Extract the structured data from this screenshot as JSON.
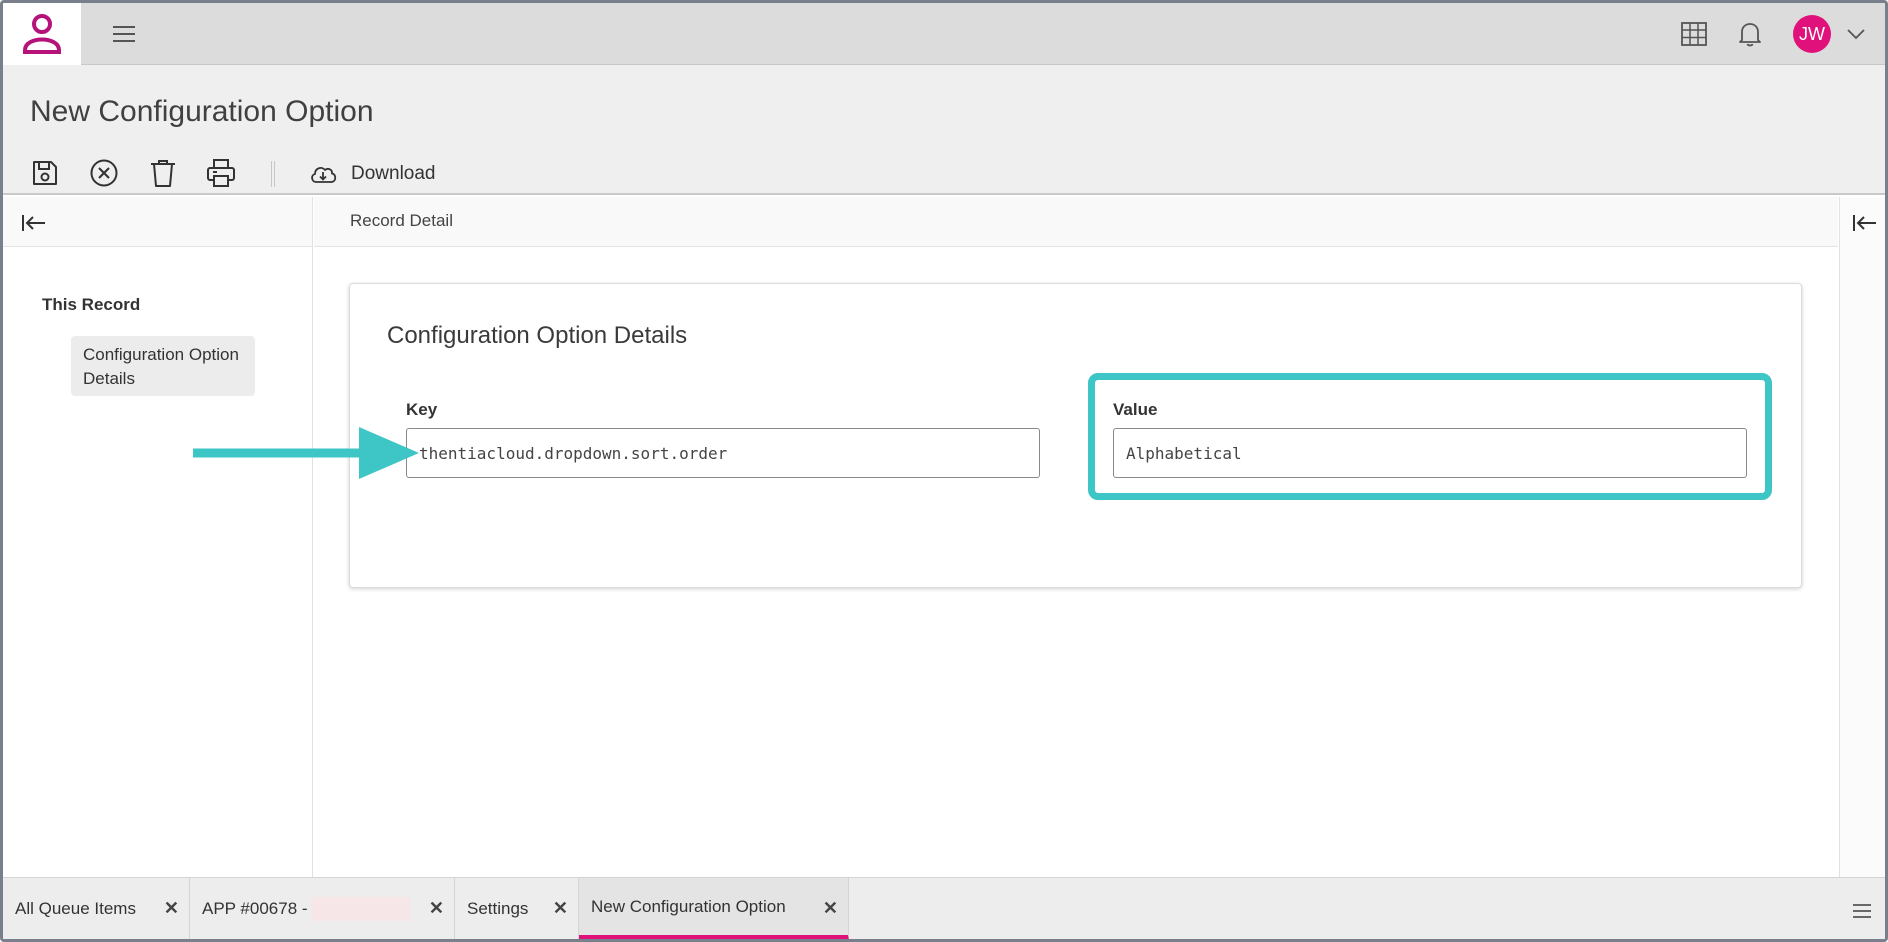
{
  "app": {
    "title": "New Configuration Option",
    "brand_color": "#e0117a",
    "accent_highlight": "#3ec5c5"
  },
  "topbar": {
    "logo_icon": "user-logo-icon",
    "menu_icon": "hamburger-icon",
    "icons": [
      "grid-icon",
      "bell-icon"
    ],
    "avatar_initials": "JW"
  },
  "toolbar": {
    "tools": [
      "save-icon",
      "cancel-icon",
      "delete-icon",
      "print-icon"
    ],
    "download_label": "Download"
  },
  "leftnav": {
    "section_label": "This Record",
    "items": [
      {
        "label": "Configuration Option Details"
      }
    ]
  },
  "main": {
    "breadcrumb": "Record Detail",
    "card_title": "Configuration Option Details",
    "fields": {
      "key": {
        "label": "Key",
        "value": "thentiacloud.dropdown.sort.order"
      },
      "value": {
        "label": "Value",
        "value": "Alphabetical"
      }
    }
  },
  "tabs": [
    {
      "label": "All Queue Items",
      "active": false
    },
    {
      "label": "APP #00678 -",
      "active": false
    },
    {
      "label": "Settings",
      "active": false
    },
    {
      "label": "New Configuration Option",
      "active": true
    }
  ]
}
